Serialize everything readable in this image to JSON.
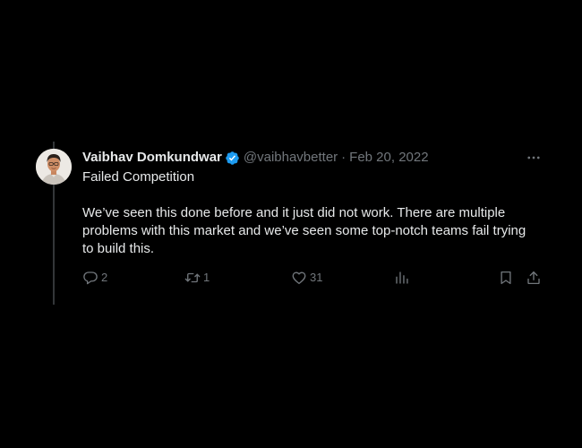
{
  "tweet": {
    "author": {
      "display_name": "Vaibhav Domkundwar",
      "handle": "@vaibhavbetter",
      "verified": true,
      "verified_color": "#1d9bf0"
    },
    "separator": "·",
    "date": "Feb 20, 2022",
    "text_title": "Failed Competition",
    "text_body": "We’ve seen this done before and it just did not work. There are multiple problems with this market and we’ve seen some top-notch teams fail trying to build this.",
    "actions": {
      "reply": {
        "icon": "reply-icon",
        "count": "2"
      },
      "retweet": {
        "icon": "retweet-icon",
        "count": "1"
      },
      "like": {
        "icon": "heart-icon",
        "count": "31"
      },
      "views": {
        "icon": "analytics-icon",
        "count": ""
      },
      "bookmark": {
        "icon": "bookmark-icon"
      },
      "share": {
        "icon": "share-icon"
      }
    },
    "more_icon": "more-icon"
  },
  "colors": {
    "background": "#000000",
    "text_primary": "#e7e9ea",
    "text_secondary": "#71767b",
    "thread_line": "#333639"
  }
}
